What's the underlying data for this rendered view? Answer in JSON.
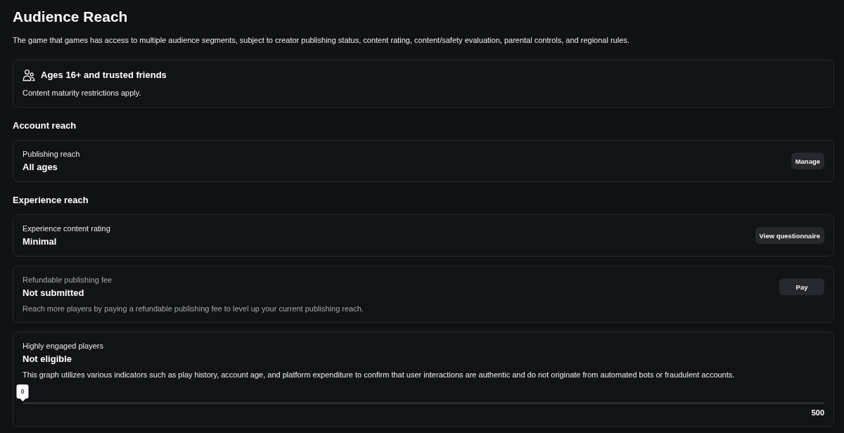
{
  "page": {
    "title": "Audience Reach",
    "description": "The game that games has access to multiple audience segments, subject to creator publishing status, content rating, content/safety evaluation, parental controls, and regional rules."
  },
  "audience_card": {
    "title": "Ages 16+ and trusted friends",
    "note": "Content maturity restrictions apply."
  },
  "sections": [
    {
      "heading": "Account reach",
      "cards": [
        {
          "label": "Publishing reach",
          "value": "All ages",
          "button": "Manage",
          "muted": false
        }
      ]
    },
    {
      "heading": "Experience reach",
      "cards": [
        {
          "label": "Experience content rating",
          "value": "Minimal",
          "button": "View questionnaire",
          "muted": false
        },
        {
          "label": "Refundable publishing fee",
          "value": "Not submitted",
          "description": "Reach more players by paying a refundable publishing fee to level up your current publishing reach.",
          "button": "Pay",
          "muted": true
        },
        {
          "label": "Highly engaged players",
          "value": "Not eligible",
          "description": "This graph utilizes various indicators such as play history, account age, and platform expenditure to confirm that user interactions are authentic and do not originate from automated bots or fraudulent accounts.",
          "muted": false,
          "slider": {
            "level": 0,
            "value_label": "0",
            "max_label": "500"
          }
        }
      ]
    }
  ]
}
